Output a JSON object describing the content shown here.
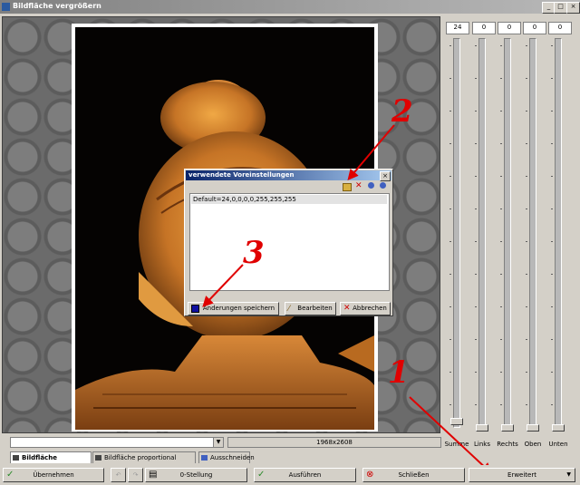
{
  "window": {
    "title": "Bildfläche vergrößern",
    "min": "_",
    "max": "□",
    "close": "×"
  },
  "sliders": {
    "values": [
      "24",
      "0",
      "0",
      "0",
      "0"
    ],
    "labels": [
      "Summe",
      "Links",
      "Rechts",
      "Oben",
      "Unten"
    ]
  },
  "dialog": {
    "title": "verwendete Voreinstellungen",
    "close": "×",
    "list_item": "Default=24,0,0,0,0,255,255,255",
    "save_label": "Änderungen speichern",
    "edit_label": "Bearbeiten",
    "cancel_label": "Abbrechen"
  },
  "annotations": {
    "one": "1",
    "two": "2",
    "three": "3"
  },
  "status": {
    "dims": "1968x2608",
    "combo_arrow": "▼"
  },
  "tabs": [
    {
      "label": "Bildfläche vergrößern"
    },
    {
      "label": "Bildfläche proportional vergrößern"
    },
    {
      "label": "Ausschneiden"
    }
  ],
  "toolbar": {
    "apply": "Übernehmen",
    "zero": "0-Stellung",
    "execute": "Ausführen",
    "close": "Schließen",
    "extended": "Erweitert",
    "extended_arrow": "▼"
  },
  "colors": {
    "annotation": "#e00000",
    "dialog_title": "#0a246a",
    "save_icon": "#1010a0"
  }
}
